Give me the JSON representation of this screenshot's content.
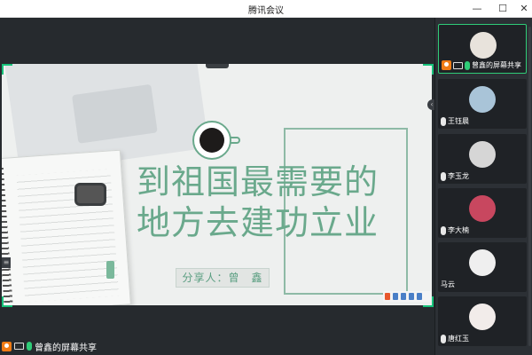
{
  "window": {
    "title": "腾讯会议",
    "min": "—",
    "max": "☐",
    "close": "✕"
  },
  "slide": {
    "headline_line1": "到祖国最需要的",
    "headline_line2": "地方去建功立业",
    "sharer": "分享人：曾　鑫"
  },
  "self_bar": {
    "label": "曾鑫的屏幕共享"
  },
  "participants": [
    {
      "name": "曾鑫的屏幕共享",
      "active": true,
      "avatar_color": "#e8e3dc"
    },
    {
      "name": "王钰晨",
      "active": false,
      "avatar_color": "#a9c4d8"
    },
    {
      "name": "李玉龙",
      "active": false,
      "avatar_color": "#d6d6d6"
    },
    {
      "name": "李大楠",
      "active": false,
      "avatar_color": "#c8475f"
    },
    {
      "name": "马云",
      "active": false,
      "avatar_color": "#efefef"
    },
    {
      "name": "唐红玉",
      "active": false,
      "avatar_color": "#f2ecea"
    }
  ],
  "colors": {
    "accent": "#16c27a",
    "slide_green": "#6aa98c",
    "background": "#262a2e"
  }
}
